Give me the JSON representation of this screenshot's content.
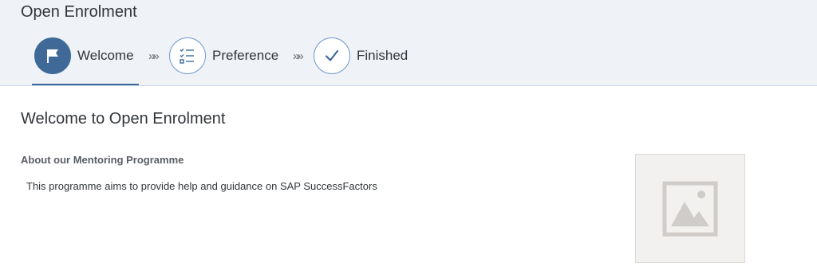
{
  "page": {
    "title": "Open Enrolment"
  },
  "wizard": {
    "steps": [
      {
        "label": "Welcome",
        "icon": "flag-icon",
        "state": "active"
      },
      {
        "label": "Preference",
        "icon": "checklist-icon",
        "state": "pending"
      },
      {
        "label": "Finished",
        "icon": "checkmark-icon",
        "state": "pending"
      }
    ],
    "separator": "»»"
  },
  "content": {
    "title": "Welcome to Open Enrolment",
    "section_title": "About our Mentoring Programme",
    "section_body": "This programme aims to provide help and guidance on SAP SuccessFactors",
    "image_icon": "image-placeholder-icon"
  },
  "colors": {
    "accent": "#3f6a98",
    "header_bg": "#eff3f8"
  }
}
